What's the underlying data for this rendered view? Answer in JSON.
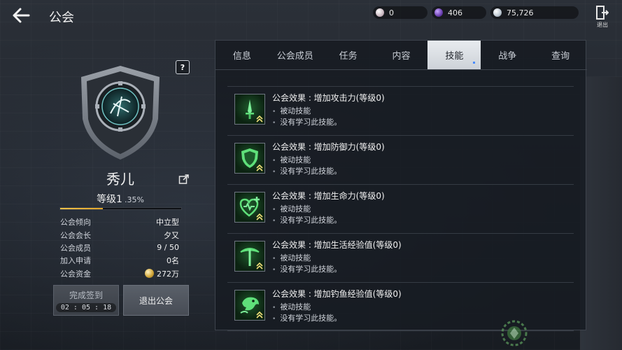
{
  "header": {
    "title": "公会",
    "currencies": [
      {
        "icon": "pearl-icon",
        "value": "0"
      },
      {
        "icon": "crystal-icon",
        "value": "406"
      },
      {
        "icon": "silver-coin-icon",
        "value": "75,726"
      }
    ],
    "exit_label": "退出"
  },
  "guild": {
    "name": "秀儿",
    "level_label": "等级1",
    "level_percent": ".35%",
    "progress_fraction": 0.35,
    "stats": [
      {
        "key": "公会倾向",
        "value": "中立型"
      },
      {
        "key": "公会会长",
        "value": "夕又"
      },
      {
        "key": "公会成员",
        "value": "9 / 50"
      },
      {
        "key": "加入申请",
        "value": "0名"
      },
      {
        "key": "公会资金",
        "value": "272万"
      }
    ],
    "checkin_label": "完成签到",
    "checkin_timer": "02 : 05 : 18",
    "leave_label": "退出公会"
  },
  "tabs": [
    "信息",
    "公会成员",
    "任务",
    "内容",
    "技能",
    "战争",
    "查询"
  ],
  "active_tab_index": 4,
  "skills": [
    {
      "icon": "sword-icon",
      "title": "公会效果 : 增加攻击力(等级0)",
      "type": "被动技能",
      "note": "没有学习此技能。"
    },
    {
      "icon": "shield-icon",
      "title": "公会效果 : 增加防御力(等级0)",
      "type": "被动技能",
      "note": "没有学习此技能。"
    },
    {
      "icon": "heart-plus-icon",
      "title": "公会效果 : 增加生命力(等级0)",
      "type": "被动技能",
      "note": "没有学习此技能。"
    },
    {
      "icon": "pickaxe-icon",
      "title": "公会效果 : 增加生活经验值(等级0)",
      "type": "被动技能",
      "note": "没有学习此技能。"
    },
    {
      "icon": "fish-icon",
      "title": "公会效果 : 增加钓鱼经验值(等级0)",
      "type": "被动技能",
      "note": "没有学习此技能。"
    }
  ],
  "colors": {
    "accent_gold": "#e0a52a",
    "skill_green": "#5fe07a",
    "active_tab": "#e8ebef"
  }
}
